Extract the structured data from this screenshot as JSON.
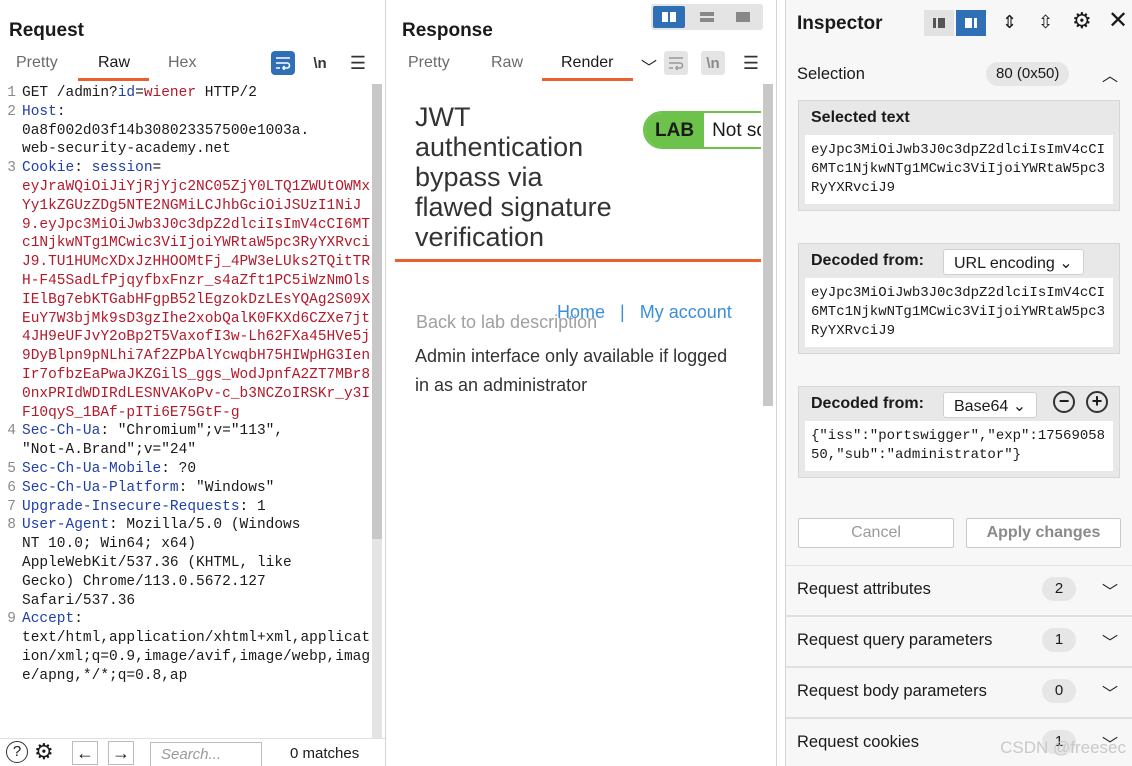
{
  "request": {
    "title": "Request",
    "tabs": [
      "Pretty",
      "Raw",
      "Hex"
    ],
    "active_tab": "Raw",
    "toolbar": {
      "newline_label": "\\n"
    },
    "lines": [
      {
        "num": "1",
        "parts": [
          {
            "t": "GET /admin?",
            "c": "p"
          },
          {
            "t": "id",
            "c": "k"
          },
          {
            "t": "=",
            "c": "p"
          },
          {
            "t": "wiener",
            "c": "v"
          },
          {
            "t": " HTTP/2",
            "c": "p"
          }
        ]
      },
      {
        "num": "2",
        "parts": [
          {
            "t": "Host",
            "c": "k"
          },
          {
            "t": ":\n0a8f002d03f14b308023357500e1003a.\nweb-security-academy.net",
            "c": "p"
          }
        ]
      },
      {
        "num": "3",
        "parts": [
          {
            "t": "Cookie",
            "c": "k"
          },
          {
            "t": ": ",
            "c": "p"
          },
          {
            "t": "session",
            "c": "k"
          },
          {
            "t": "=\n",
            "c": "p"
          },
          {
            "t": "eyJraWQiOiJiYjRjYjc2NC05ZjY0LTQ1ZWUtOWMxYy1kZGUzZDg5NTE2NGMiLCJhbGciOiJSUzI1NiJ9.eyJpc3MiOiJwb3J0c3dpZ2dlciIsImV4cCI6MTc1NjkwNTg1MCwic3ViIjoiYWRtaW5pc3RyYXRvciJ9.TU1HUMcXDxJzHHOOMtFj_4PW3eLUks2TQitTRH-F45SadLfPjqyfbxFnzr_s4aZft1PC5iWzNmOlsIElBg7ebKTGabHFgpB52lEgzokDzLEsYQAg2S09XEuY7W3bjMk9sD3gzIhe2xobQalK0FKXd6CZXe7jt4JH9eUFJvY2oBp2T5VaxofI3w-Lh62FXa45HVe5j9DyBlpn9pNLhi7Af2ZPbAlYcwqbH75HIWpHG3IenIr7ofbzEaPwaJKZGilS_ggs_WodJpnfA2ZT7MBr80nxPRIdWDIRdLESNVAKoPv-c_b3NCZoIRSKr_y3IF10qyS_1BAf-pITi6E75GtF-g",
            "c": "v"
          }
        ]
      },
      {
        "num": "4",
        "parts": [
          {
            "t": "Sec-Ch-Ua",
            "c": "k"
          },
          {
            "t": ": \"Chromium\";v=\"113\",\n\"Not-A.Brand\";v=\"24\"",
            "c": "p"
          }
        ]
      },
      {
        "num": "5",
        "parts": [
          {
            "t": "Sec-Ch-Ua-Mobile",
            "c": "k"
          },
          {
            "t": ": ?0",
            "c": "p"
          }
        ]
      },
      {
        "num": "6",
        "parts": [
          {
            "t": "Sec-Ch-Ua-Platform",
            "c": "k"
          },
          {
            "t": ": \"Windows\"",
            "c": "p"
          }
        ]
      },
      {
        "num": "7",
        "parts": [
          {
            "t": "Upgrade-Insecure-Requests",
            "c": "k"
          },
          {
            "t": ": 1",
            "c": "p"
          }
        ]
      },
      {
        "num": "8",
        "parts": [
          {
            "t": "User-Agent",
            "c": "k"
          },
          {
            "t": ": Mozilla/5.0 (Windows\nNT 10.0; Win64; x64)\nAppleWebKit/537.36 (KHTML, like\nGecko) Chrome/113.0.5672.127\nSafari/537.36",
            "c": "p"
          }
        ]
      },
      {
        "num": "9",
        "parts": [
          {
            "t": "Accept",
            "c": "k"
          },
          {
            "t": ":\ntext/html,application/xhtml+xml,application/xml;q=0.9,image/avif,image/webp,image/apng,*/*;q=0.8,ap",
            "c": "p"
          }
        ]
      }
    ],
    "search_placeholder": "Search...",
    "matches": "0 matches"
  },
  "response": {
    "title": "Response",
    "tabs": [
      "Pretty",
      "Raw",
      "Render"
    ],
    "active_tab": "Render",
    "toolbar": {
      "newline_label": "\\n"
    },
    "render": {
      "heading": "JWT authentication bypass via flawed signature verification",
      "lab_label": "LAB",
      "lab_status": "Not solved",
      "nav_home": "Home",
      "nav_sep": "|",
      "nav_account": "My account",
      "back_link": "Back to lab description",
      "message": "Admin interface only available if logged in as an administrator"
    }
  },
  "inspector": {
    "title": "Inspector",
    "selection_label": "Selection",
    "selection_value": "80 (0x50)",
    "selected_text_label": "Selected text",
    "selected_text": "eyJpc3MiOiJwb3J0c3dpZ2dlciIsImV4cCI6MTc1NjkwNTg1MCwic3ViIjoiYWRtaW5pc3RyYXRvciJ9",
    "decoded1_label": "Decoded from:",
    "decoded1_encoding": "URL encoding",
    "decoded1_text": "eyJpc3MiOiJwb3J0c3dpZ2dlciIsImV4cCI6MTc1NjkwNTg1MCwic3ViIjoiYWRtaW5pc3RyYXRvciJ9",
    "decoded2_label": "Decoded from:",
    "decoded2_encoding": "Base64",
    "decoded2_text": "{\"iss\":\"portswigger\",\"exp\":1756905850,\"sub\":\"administrator\"}",
    "cancel_label": "Cancel",
    "apply_label": "Apply changes",
    "sections": [
      {
        "label": "Request attributes",
        "count": "2"
      },
      {
        "label": "Request query parameters",
        "count": "1"
      },
      {
        "label": "Request body parameters",
        "count": "0"
      },
      {
        "label": "Request cookies",
        "count": "1"
      }
    ],
    "watermark": "CSDN @freesec"
  }
}
